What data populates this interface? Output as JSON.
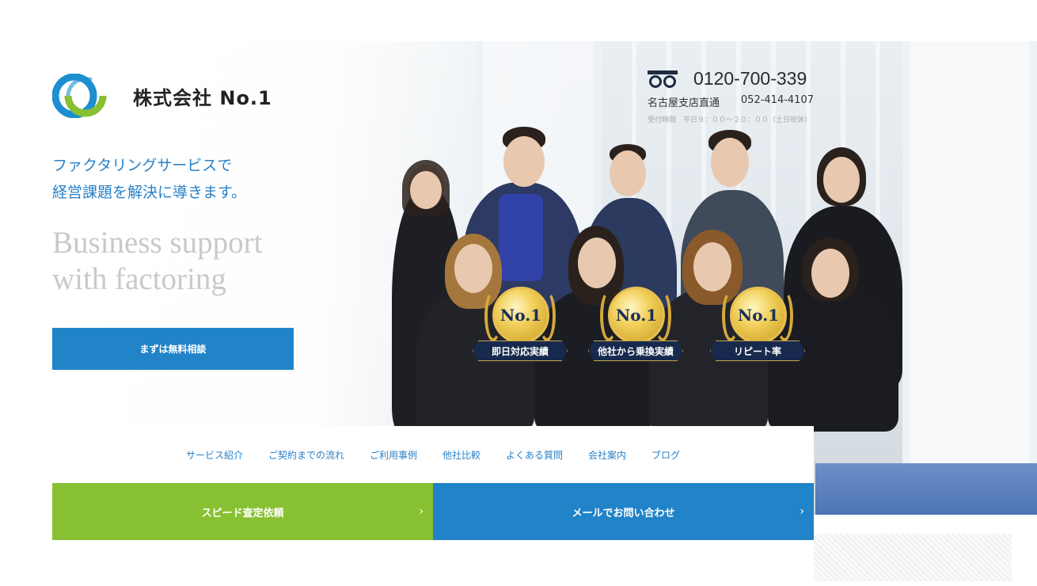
{
  "brand": {
    "company_name": "株式会社 No.1",
    "colors": {
      "blue": "#2183c8",
      "green": "#88c133",
      "navy": "#172a4e",
      "gold": "#d6a93a"
    },
    "logo_icon": "swirl-logo-icon"
  },
  "contact": {
    "freedial_icon": "freedial-icon",
    "tel": "0120-700-339",
    "branch_label": "名古屋支店直通",
    "branch_tel": "052-414-4107",
    "hours": "受付時間　平日９：００～２０：００（土日祝休）"
  },
  "hero": {
    "tagline_jp_line1": "ファクタリングサービスで",
    "tagline_jp_line2": "経営課題を解決に導きます。",
    "tagline_en_line1": "Business support",
    "tagline_en_line2": "with factoring",
    "cta_label": "まずは無料相談"
  },
  "badges": [
    {
      "medal_text": "No.1",
      "label": "即日対応実績"
    },
    {
      "medal_text": "No.1",
      "label": "他社から乗換実績"
    },
    {
      "medal_text": "No.1",
      "label": "リピート率"
    }
  ],
  "nav": {
    "items": [
      "サービス紹介",
      "ご契約までの流れ",
      "ご利用事例",
      "他社比較",
      "よくある質問",
      "会社案内",
      "ブログ"
    ]
  },
  "actions": {
    "speed_label": "スピード査定依頼",
    "mail_label": "メールでお問い合わせ",
    "chevron": "›"
  }
}
